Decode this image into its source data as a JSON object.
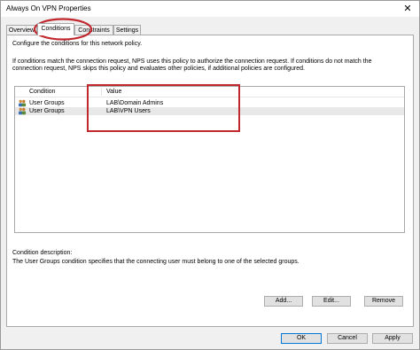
{
  "window": {
    "title": "Always On VPN Properties",
    "close_glyph": "✕"
  },
  "tabs": [
    {
      "label": "Overview"
    },
    {
      "label": "Conditions"
    },
    {
      "label": "Constraints"
    },
    {
      "label": "Settings"
    }
  ],
  "conditions": {
    "intro": "Configure the conditions for this network policy.",
    "help_line1": "If conditions match the connection request, NPS uses this policy to authorize the connection request. If conditions do not match the",
    "help_line2": "connection request, NPS skips this policy and evaluates other policies, if additional policies are configured.",
    "columns": {
      "condition": "Condition",
      "value": "Value"
    },
    "rows": [
      {
        "condition": "User Groups",
        "value": "LAB\\Domain Admins",
        "icon": "user-group-icon"
      },
      {
        "condition": "User Groups",
        "value": "LAB\\VPN Users",
        "icon": "user-group-icon"
      }
    ],
    "description_label": "Condition description:",
    "description_text": "The User Groups condition specifies that the connecting user must belong to one of the selected groups.",
    "buttons": {
      "add": "Add...",
      "edit": "Edit...",
      "remove": "Remove"
    }
  },
  "footer": {
    "ok": "OK",
    "cancel": "Cancel",
    "apply": "Apply"
  },
  "colors": {
    "annotation": "#c0282e",
    "selection": "#e8e8e8",
    "focus": "#0078d7"
  }
}
